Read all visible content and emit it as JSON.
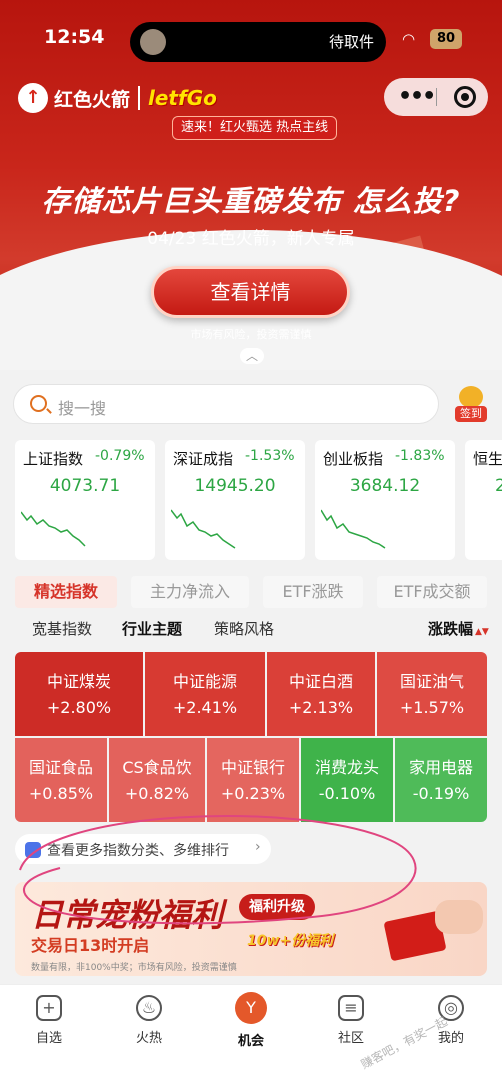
{
  "status_bar": {
    "time": "12:54",
    "island_label": "待取件",
    "battery": "80"
  },
  "header": {
    "brand_name": "红色火箭",
    "brand_partner": "letfGo",
    "tagline_badge": "速来！红火甄选 热点主线",
    "headline": "存储芯片巨头重磅发布 怎么投?",
    "subline": "04/23 红色火箭，新人专属",
    "detail_button": "查看详情",
    "risk_note": "市场有风险，投资需谨慎",
    "expand_chevron": "︿"
  },
  "search": {
    "placeholder": "搜一搜",
    "sign_label": "签到"
  },
  "index_cards": [
    {
      "name": "上证指数",
      "change": "-0.79%",
      "value": "4073.71"
    },
    {
      "name": "深证成指",
      "change": "-1.53%",
      "value": "14945.20"
    },
    {
      "name": "创业板指",
      "change": "-1.83%",
      "value": "3684.12"
    },
    {
      "name": "恒生",
      "change": "",
      "value": "2"
    }
  ],
  "tabs": [
    "精选指数",
    "主力净流入",
    "ETF涨跌",
    "ETF成交额"
  ],
  "subtabs": [
    "宽基指数",
    "行业主题",
    "策略风格"
  ],
  "sort_label": "涨跌幅",
  "heat_grid": [
    {
      "name": "中证煤炭",
      "change": "+2.80%"
    },
    {
      "name": "中证能源",
      "change": "+2.41%"
    },
    {
      "name": "中证白酒",
      "change": "+2.13%"
    },
    {
      "name": "国证油气",
      "change": "+1.57%"
    },
    {
      "name": "国证食品",
      "change": "+0.85%"
    },
    {
      "name": "CS食品饮",
      "change": "+0.82%"
    },
    {
      "name": "中证银行",
      "change": "+0.23%"
    },
    {
      "name": "消费龙头",
      "change": "-0.10%"
    },
    {
      "name": "家用电器",
      "change": "-0.19%"
    }
  ],
  "more_link": {
    "label": "查看更多指数分类、多维排行",
    "arrow": "›"
  },
  "promo": {
    "title": "日常宠粉福利",
    "upgrade": "福利升级",
    "subtitle": "交易日13时开启",
    "bonus": "10w+份福利",
    "note": "数量有限，非100%中奖；市场有风险，投资需谨慎"
  },
  "nav": [
    {
      "label": "自选",
      "icon": "+"
    },
    {
      "label": "火热",
      "icon": "♨"
    },
    {
      "label": "机会",
      "icon": "Y"
    },
    {
      "label": "社区",
      "icon": "≡"
    },
    {
      "label": "我的",
      "icon": "◎"
    }
  ],
  "watermark": "赚客吧，有奖一起",
  "colors": {
    "red": "#d6342a",
    "green": "#2da644",
    "up_strong": "#cd2c26",
    "up_mid": "#de4b43",
    "up_light": "#e3625c",
    "down_green": "#3fb34a"
  }
}
